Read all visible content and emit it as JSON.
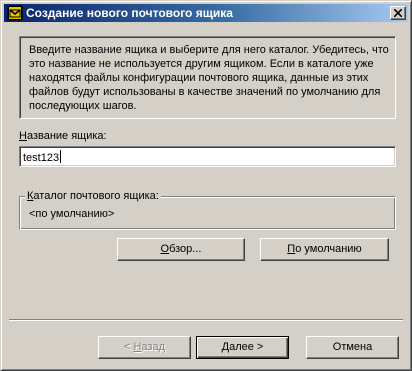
{
  "window": {
    "title": "Создание нового почтового ящика",
    "icon": "app-envelope-icon",
    "close_icon": "close-icon"
  },
  "intro": {
    "text": "Введите название ящика и выберите для него каталог. Убедитесь, что это название не используется другим ящиком. Если в каталоге уже находятся файлы конфигурации почтового ящика, данные из этих файлов будут использованы в качестве значений по умолчанию для последующих шагов."
  },
  "name_field": {
    "label_accel": "Н",
    "label_rest": "азвание ящика:",
    "value": "test123"
  },
  "folder_group": {
    "legend_accel": "К",
    "legend_rest": "аталог почтового ящика:",
    "value": "<по умолчанию>"
  },
  "buttons": {
    "browse_accel": "О",
    "browse_rest": "бзор...",
    "default_accel": "П",
    "default_rest": "о умолчанию",
    "back_prefix": "< ",
    "back_accel": "Н",
    "back_rest": "азад",
    "next_accel": "Д",
    "next_rest": "алее >",
    "cancel": "Отмена"
  }
}
